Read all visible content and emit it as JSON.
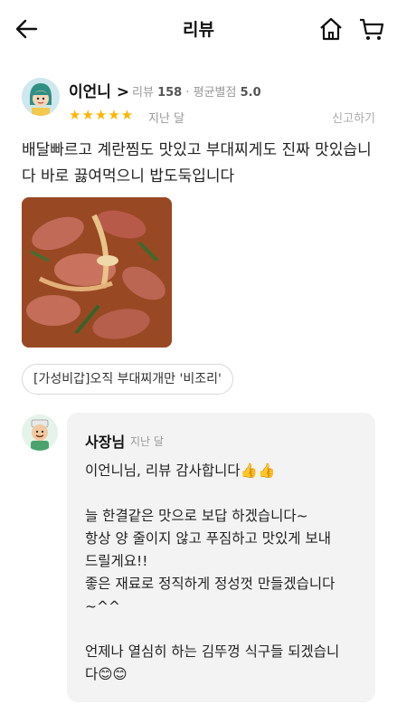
{
  "header": {
    "title": "리뷰"
  },
  "icons": {
    "back": "arrow-left-icon",
    "home": "home-icon",
    "cart": "cart-icon",
    "chevron": "chevron-right-icon",
    "star": "star-icon",
    "emoji_thumb": "thumbs-up-emoji",
    "emoji_smile": "smile-emoji"
  },
  "review": {
    "user_name": "이언니 >",
    "review_count_label": "리뷰",
    "review_count": "158",
    "separator": "·",
    "avg_rating_label": "평균별점",
    "avg_rating": "5.0",
    "stars": "★★★★★",
    "rating": 5,
    "date": "지난 달",
    "report": "신고하기",
    "text": "배달빠르고 계란찜도 맛있고 부대찌게도 진짜 맛있습니다 바로 끓여먹으니 밥도둑입니다",
    "menu_tag": "[가성비갑]오직 부대찌개만 '비조리'"
  },
  "reply": {
    "owner_name": "사장님",
    "date": "지난 달",
    "lines": [
      "이언니님, 리뷰 감사합니다👍👍",
      "",
      "늘 한결같은 맛으로 보답 하겠습니다~",
      "항상 양 줄이지 않고 푸짐하고 맛있게 보내",
      "드릴게요!!",
      "좋은 재료로 정직하게 정성껏 만들겠습니다",
      "~^^",
      "",
      "언제나 열심히 하는 김뚜껑 식구들 되겠습니",
      "다😊😊"
    ]
  },
  "colors": {
    "star": "#ffb400",
    "reply_bg": "#f3f3f3"
  }
}
